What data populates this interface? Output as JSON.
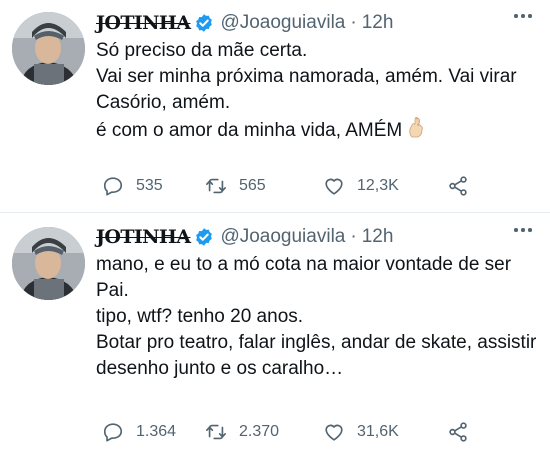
{
  "colors": {
    "text": "#0f1419",
    "secondary": "#536471",
    "verified": "#1d9bf0",
    "divider": "#e6ecf0"
  },
  "tweets": [
    {
      "display_name": "JOTINHA",
      "handle": "@Joaoguiavila",
      "separator": "·",
      "time": "12h",
      "lines": [
        "Só preciso da mãe certa.",
        "Vai ser minha próxima namorada, amém. Vai virar Casório, amém.",
        "é com o amor da minha vida, AMÉM"
      ],
      "emoji": "crossed-fingers-emoji",
      "replies": "535",
      "retweets": "565",
      "likes": "12,3K"
    },
    {
      "display_name": "JOTINHA",
      "handle": "@Joaoguiavila",
      "separator": "·",
      "time": "12h",
      "lines": [
        "mano, e eu to a mó cota na maior vontade de ser Pai.",
        "tipo, wtf? tenho 20 anos.",
        "Botar pro teatro, falar inglês, andar de skate, assistir desenho junto e os caralho…"
      ],
      "replies": "1.364",
      "retweets": "2.370",
      "likes": "31,6K"
    }
  ]
}
